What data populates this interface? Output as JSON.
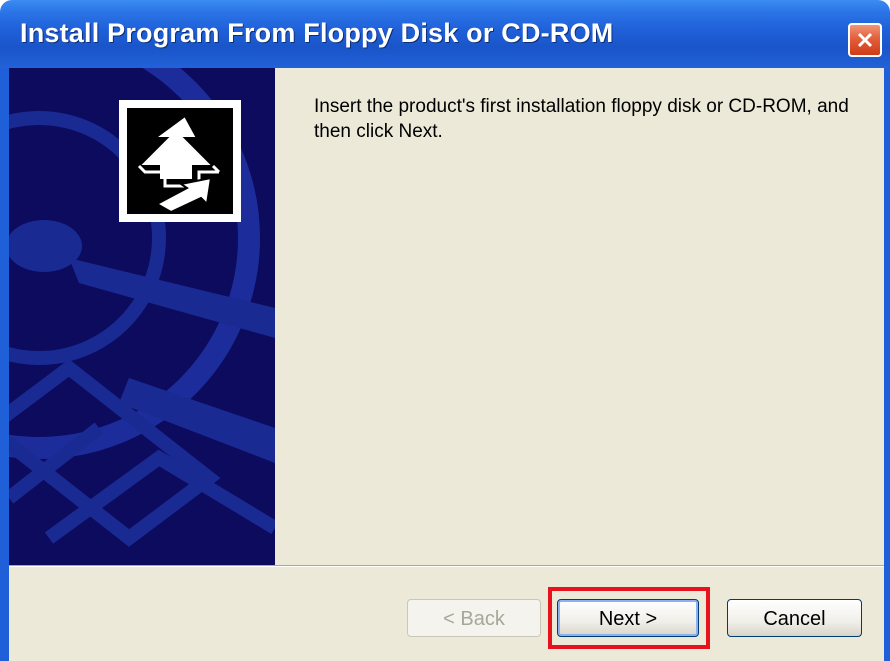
{
  "window": {
    "title": "Install Program From Floppy Disk or CD-ROM"
  },
  "instruction_text": "Insert the product's first installation floppy disk or CD-ROM, and then click Next.",
  "buttons": {
    "back_label": "< Back",
    "next_label": "Next >",
    "cancel_label": "Cancel"
  },
  "button_states": {
    "back_enabled": false,
    "next_highlighted": true
  },
  "icons": {
    "close": "close-icon",
    "install": "install-arrow-icon",
    "banner_art": "cd-disc-watermark"
  },
  "colors": {
    "titlebar": "#1f5fd8",
    "banner": "#0c0b5e",
    "content_bg": "#ece9d8",
    "highlight": "#e8121c",
    "close_button": "#e35f3b"
  }
}
